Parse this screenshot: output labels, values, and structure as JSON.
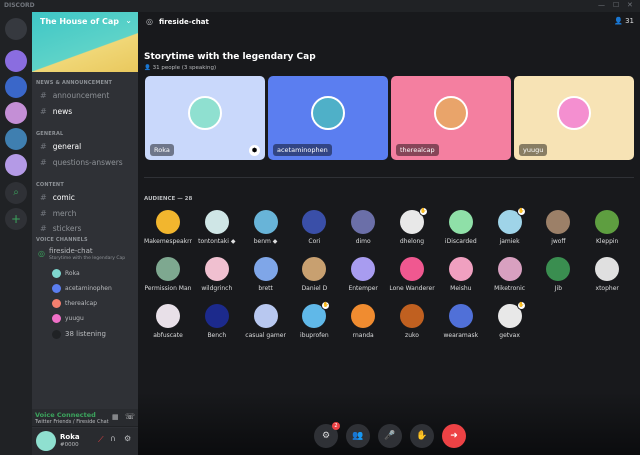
{
  "app": {
    "brand": "DISCORD",
    "window_controls": [
      "—",
      "☐",
      "✕"
    ]
  },
  "servers": [
    {
      "name": "home",
      "color": "#36393f"
    },
    {
      "name": "server-1",
      "color": "#8a6de0"
    },
    {
      "name": "server-2",
      "color": "#3a67c9"
    },
    {
      "name": "server-3",
      "color": "#c48fd6"
    },
    {
      "name": "server-4",
      "color": "#3f7fb0"
    },
    {
      "name": "server-5",
      "color": "#b49ae6"
    }
  ],
  "sidebar": {
    "server_name": "The House of Cap",
    "categories": [
      {
        "label": "NEWS & ANNOUNCEMENT",
        "channels": [
          {
            "name": "announcement",
            "unread": false
          },
          {
            "name": "news",
            "unread": true
          }
        ]
      },
      {
        "label": "GENERAL",
        "channels": [
          {
            "name": "general",
            "unread": true
          },
          {
            "name": "questions-answers",
            "unread": false
          }
        ]
      },
      {
        "label": "CONTENT",
        "channels": [
          {
            "name": "comic",
            "unread": true
          },
          {
            "name": "merch",
            "unread": false
          },
          {
            "name": "stickers",
            "unread": false
          }
        ]
      }
    ],
    "voice_category": "VOICE CHANNELS",
    "stage": {
      "name": "fireside-chat",
      "topic": "Storytime with the legendary Cap"
    },
    "voice_users": [
      {
        "name": "Roka",
        "color": "#7fd8d0"
      },
      {
        "name": "acetaminophen",
        "color": "#5b7ef0"
      },
      {
        "name": "therealcap",
        "color": "#f47f6f"
      },
      {
        "name": "yuugu",
        "color": "#f070c8"
      }
    ],
    "listening": "38 listening",
    "voice_status": "Voice Connected",
    "voice_location": "Twitter Friends / Fireside Chat",
    "user": {
      "name": "Roka",
      "tag": "#0000"
    }
  },
  "header": {
    "channel": "fireside-chat",
    "member_count": "31"
  },
  "stage": {
    "title": "Storytime with the legendary Cap",
    "subtitle": "31 people (3 speaking)",
    "speakers": [
      {
        "name": "Roka",
        "bg": "#c9d8fb",
        "av": "#8fe0d0"
      },
      {
        "name": "acetaminophen",
        "bg": "#5b7ef0",
        "av": "#4fb0c8"
      },
      {
        "name": "therealcap",
        "bg": "#f47fa0",
        "av": "#e9a46a"
      },
      {
        "name": "yuugu",
        "bg": "#f7e3b5",
        "av": "#f48fd0"
      }
    ],
    "audience_label": "AUDIENCE — 28",
    "audience": [
      {
        "name": "Makemespeakrr",
        "color": "#f2b62e"
      },
      {
        "name": "tontontaki ◆",
        "color": "#cfe6e6"
      },
      {
        "name": "benm ◆",
        "color": "#68b4d8"
      },
      {
        "name": "Cori",
        "color": "#3a4fa8"
      },
      {
        "name": "dimo",
        "color": "#6b6fa8"
      },
      {
        "name": "dhelong",
        "color": "#e8e8e8",
        "hand": true
      },
      {
        "name": "iDiscarded",
        "color": "#8fe0a8"
      },
      {
        "name": "jamiek",
        "color": "#9fd4e8",
        "hand": true
      },
      {
        "name": "jwoff",
        "color": "#9c8068"
      },
      {
        "name": "Kleppin",
        "color": "#5e9e40"
      },
      {
        "name": "Permission Man",
        "color": "#7ea890"
      },
      {
        "name": "wildgrinch",
        "color": "#f0c0d0"
      },
      {
        "name": "brett",
        "color": "#7fa6e8"
      },
      {
        "name": "Daniel D",
        "color": "#c8a070"
      },
      {
        "name": "Entemper",
        "color": "#a89cf0"
      },
      {
        "name": "Lone Wanderer",
        "color": "#f05890"
      },
      {
        "name": "Meishu",
        "color": "#f0a0c0"
      },
      {
        "name": "Miketronic",
        "color": "#d8a0c0"
      },
      {
        "name": "Jib",
        "color": "#3a8e50"
      },
      {
        "name": "xtopher",
        "color": "#e0e0e0"
      },
      {
        "name": "abfuscate",
        "color": "#e8e0e8"
      },
      {
        "name": "Bench",
        "color": "#1c2a8c"
      },
      {
        "name": "casual gamer",
        "color": "#b8c8f0"
      },
      {
        "name": "ibuprofen",
        "color": "#60b8e8",
        "hand": true
      },
      {
        "name": "rnanda",
        "color": "#f08c30"
      },
      {
        "name": "zuko",
        "color": "#c06020"
      },
      {
        "name": "wearamask",
        "color": "#5070d8"
      },
      {
        "name": "getvax",
        "color": "#e8e8e8",
        "hand": true
      }
    ]
  },
  "controls": {
    "buttons": [
      {
        "name": "activity",
        "glyph": "⚙",
        "badge": "2"
      },
      {
        "name": "invite",
        "glyph": "👥"
      },
      {
        "name": "mic",
        "glyph": "🎤"
      },
      {
        "name": "request-speak",
        "glyph": "✋"
      },
      {
        "name": "leave",
        "glyph": "➜"
      }
    ],
    "leave_color": "#ed4245"
  },
  "colors": {
    "accent": "#5865f2",
    "voice_green": "#3ba55d",
    "danger": "#ed4245"
  }
}
